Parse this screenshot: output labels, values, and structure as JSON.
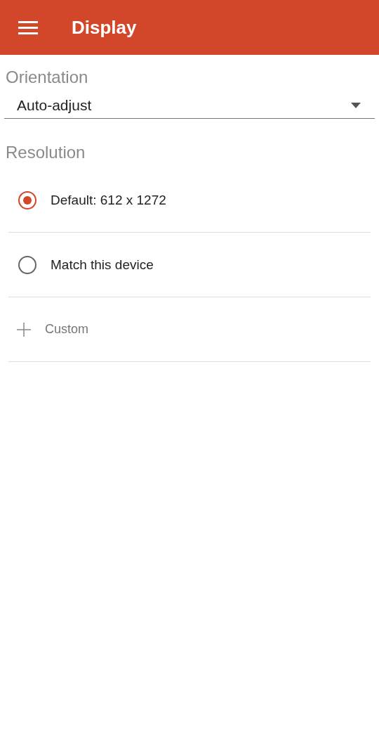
{
  "app_bar": {
    "title": "Display"
  },
  "orientation": {
    "label": "Orientation",
    "value": "Auto-adjust"
  },
  "resolution": {
    "label": "Resolution",
    "options": [
      {
        "label": "Default: 612 x 1272",
        "selected": true
      },
      {
        "label": "Match this device",
        "selected": false
      }
    ],
    "custom_action": "Custom"
  }
}
